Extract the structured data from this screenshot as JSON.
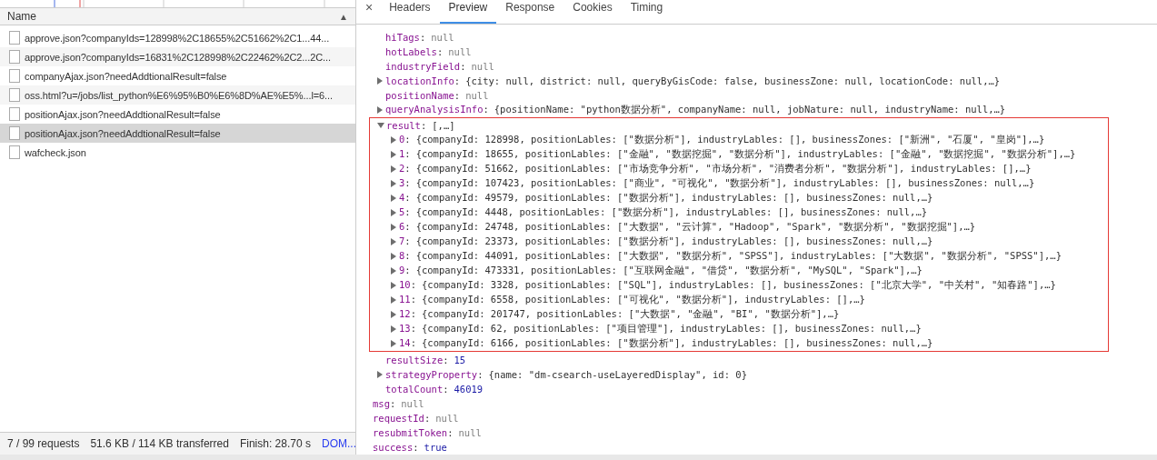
{
  "requests": {
    "column": "Name",
    "sort_indicator": "▲",
    "rows": [
      {
        "name": "approve.json?companyIds=128998%2C18655%2C51662%2C1...44...",
        "selected": false
      },
      {
        "name": "approve.json?companyIds=16831%2C128998%2C22462%2C2...2C...",
        "selected": false
      },
      {
        "name": "companyAjax.json?needAddtionalResult=false",
        "selected": false
      },
      {
        "name": "oss.html?u=/jobs/list_python%E6%95%B0%E6%8D%AE%E5%...l=6...",
        "selected": false
      },
      {
        "name": "positionAjax.json?needAddtionalResult=false",
        "selected": false
      },
      {
        "name": "positionAjax.json?needAddtionalResult=false",
        "selected": true
      },
      {
        "name": "wafcheck.json",
        "selected": false
      }
    ]
  },
  "status_bar": [
    {
      "text": "7 / 99 requests",
      "kind": "plain"
    },
    {
      "text": "51.6 KB / 114 KB transferred",
      "kind": "plain"
    },
    {
      "text": "Finish: 28.70 s",
      "kind": "plain"
    },
    {
      "text": "DOM...",
      "kind": "link"
    }
  ],
  "detail": {
    "close": "×",
    "key_separator": ":",
    "tabs": [
      {
        "label": "Headers",
        "selected": false
      },
      {
        "label": "Preview",
        "selected": true
      },
      {
        "label": "Response",
        "selected": false
      },
      {
        "label": "Cookies",
        "selected": false
      },
      {
        "label": "Timing",
        "selected": false
      }
    ],
    "tree": [
      {
        "children": [
          {
            "key": "hiTags",
            "value": "null",
            "kind": "null"
          },
          {
            "key": "hotLabels",
            "value": "null",
            "kind": "null"
          },
          {
            "key": "industryField",
            "value": "null",
            "kind": "null"
          },
          {
            "key": "locationInfo",
            "value": "{city: null, district: null, queryByGisCode: false, businessZone: null, locationCode: null,…}",
            "kind": "object",
            "expanded": false
          },
          {
            "key": "positionName",
            "value": "null",
            "kind": "null"
          },
          {
            "key": "queryAnalysisInfo",
            "value": "{positionName: \"python数据分析\", companyName: null, jobNature: null, industryName: null,…}",
            "kind": "object",
            "expanded": false
          },
          {
            "key": "result",
            "value": "[,…]",
            "kind": "object",
            "expanded": true,
            "highlighted": true,
            "children": [
              {
                "key": "0",
                "value": "{companyId: 128998, positionLables: [\"数据分析\"], industryLables: [], businessZones: [\"新洲\", \"石厦\", \"皇岗\"],…}",
                "kind": "object",
                "expanded": false
              },
              {
                "key": "1",
                "value": "{companyId: 18655, positionLables: [\"金融\", \"数据挖掘\", \"数据分析\"], industryLables: [\"金融\", \"数据挖掘\", \"数据分析\"],…}",
                "kind": "object",
                "expanded": false
              },
              {
                "key": "2",
                "value": "{companyId: 51662, positionLables: [\"市场竞争分析\", \"市场分析\", \"消费者分析\", \"数据分析\"], industryLables: [],…}",
                "kind": "object",
                "expanded": false
              },
              {
                "key": "3",
                "value": "{companyId: 107423, positionLables: [\"商业\", \"可视化\", \"数据分析\"], industryLables: [], businessZones: null,…}",
                "kind": "object",
                "expanded": false
              },
              {
                "key": "4",
                "value": "{companyId: 49579, positionLables: [\"数据分析\"], industryLables: [], businessZones: null,…}",
                "kind": "object",
                "expanded": false
              },
              {
                "key": "5",
                "value": "{companyId: 4448, positionLables: [\"数据分析\"], industryLables: [], businessZones: null,…}",
                "kind": "object",
                "expanded": false
              },
              {
                "key": "6",
                "value": "{companyId: 24748, positionLables: [\"大数据\", \"云计算\", \"Hadoop\", \"Spark\", \"数据分析\", \"数据挖掘\"],…}",
                "kind": "object",
                "expanded": false
              },
              {
                "key": "7",
                "value": "{companyId: 23373, positionLables: [\"数据分析\"], industryLables: [], businessZones: null,…}",
                "kind": "object",
                "expanded": false
              },
              {
                "key": "8",
                "value": "{companyId: 44091, positionLables: [\"大数据\", \"数据分析\", \"SPSS\"], industryLables: [\"大数据\", \"数据分析\", \"SPSS\"],…}",
                "kind": "object",
                "expanded": false
              },
              {
                "key": "9",
                "value": "{companyId: 473331, positionLables: [\"互联网金融\", \"借贷\", \"数据分析\", \"MySQL\", \"Spark\"],…}",
                "kind": "object",
                "expanded": false
              },
              {
                "key": "10",
                "value": "{companyId: 3328, positionLables: [\"SQL\"], industryLables: [], businessZones: [\"北京大学\", \"中关村\", \"知春路\"],…}",
                "kind": "object",
                "expanded": false
              },
              {
                "key": "11",
                "value": "{companyId: 6558, positionLables: [\"可视化\", \"数据分析\"], industryLables: [],…}",
                "kind": "object",
                "expanded": false
              },
              {
                "key": "12",
                "value": "{companyId: 201747, positionLables: [\"大数据\", \"金融\", \"BI\", \"数据分析\"],…}",
                "kind": "object",
                "expanded": false
              },
              {
                "key": "13",
                "value": "{companyId: 62, positionLables: [\"项目管理\"], industryLables: [], businessZones: null,…}",
                "kind": "object",
                "expanded": false
              },
              {
                "key": "14",
                "value": "{companyId: 6166, positionLables: [\"数据分析\"], industryLables: [], businessZones: null,…}",
                "kind": "object",
                "expanded": false
              }
            ]
          },
          {
            "key": "resultSize",
            "value": "15",
            "kind": "number"
          },
          {
            "key": "strategyProperty",
            "value": "{name: \"dm-csearch-useLayeredDisplay\", id: 0}",
            "kind": "object",
            "expanded": false
          },
          {
            "key": "totalCount",
            "value": "46019",
            "kind": "number"
          }
        ]
      },
      {
        "key": "msg",
        "value": "null",
        "kind": "null"
      },
      {
        "key": "requestId",
        "value": "null",
        "kind": "null"
      },
      {
        "key": "resubmitToken",
        "value": "null",
        "kind": "null"
      },
      {
        "key": "success",
        "value": "true",
        "kind": "boolean"
      }
    ]
  }
}
